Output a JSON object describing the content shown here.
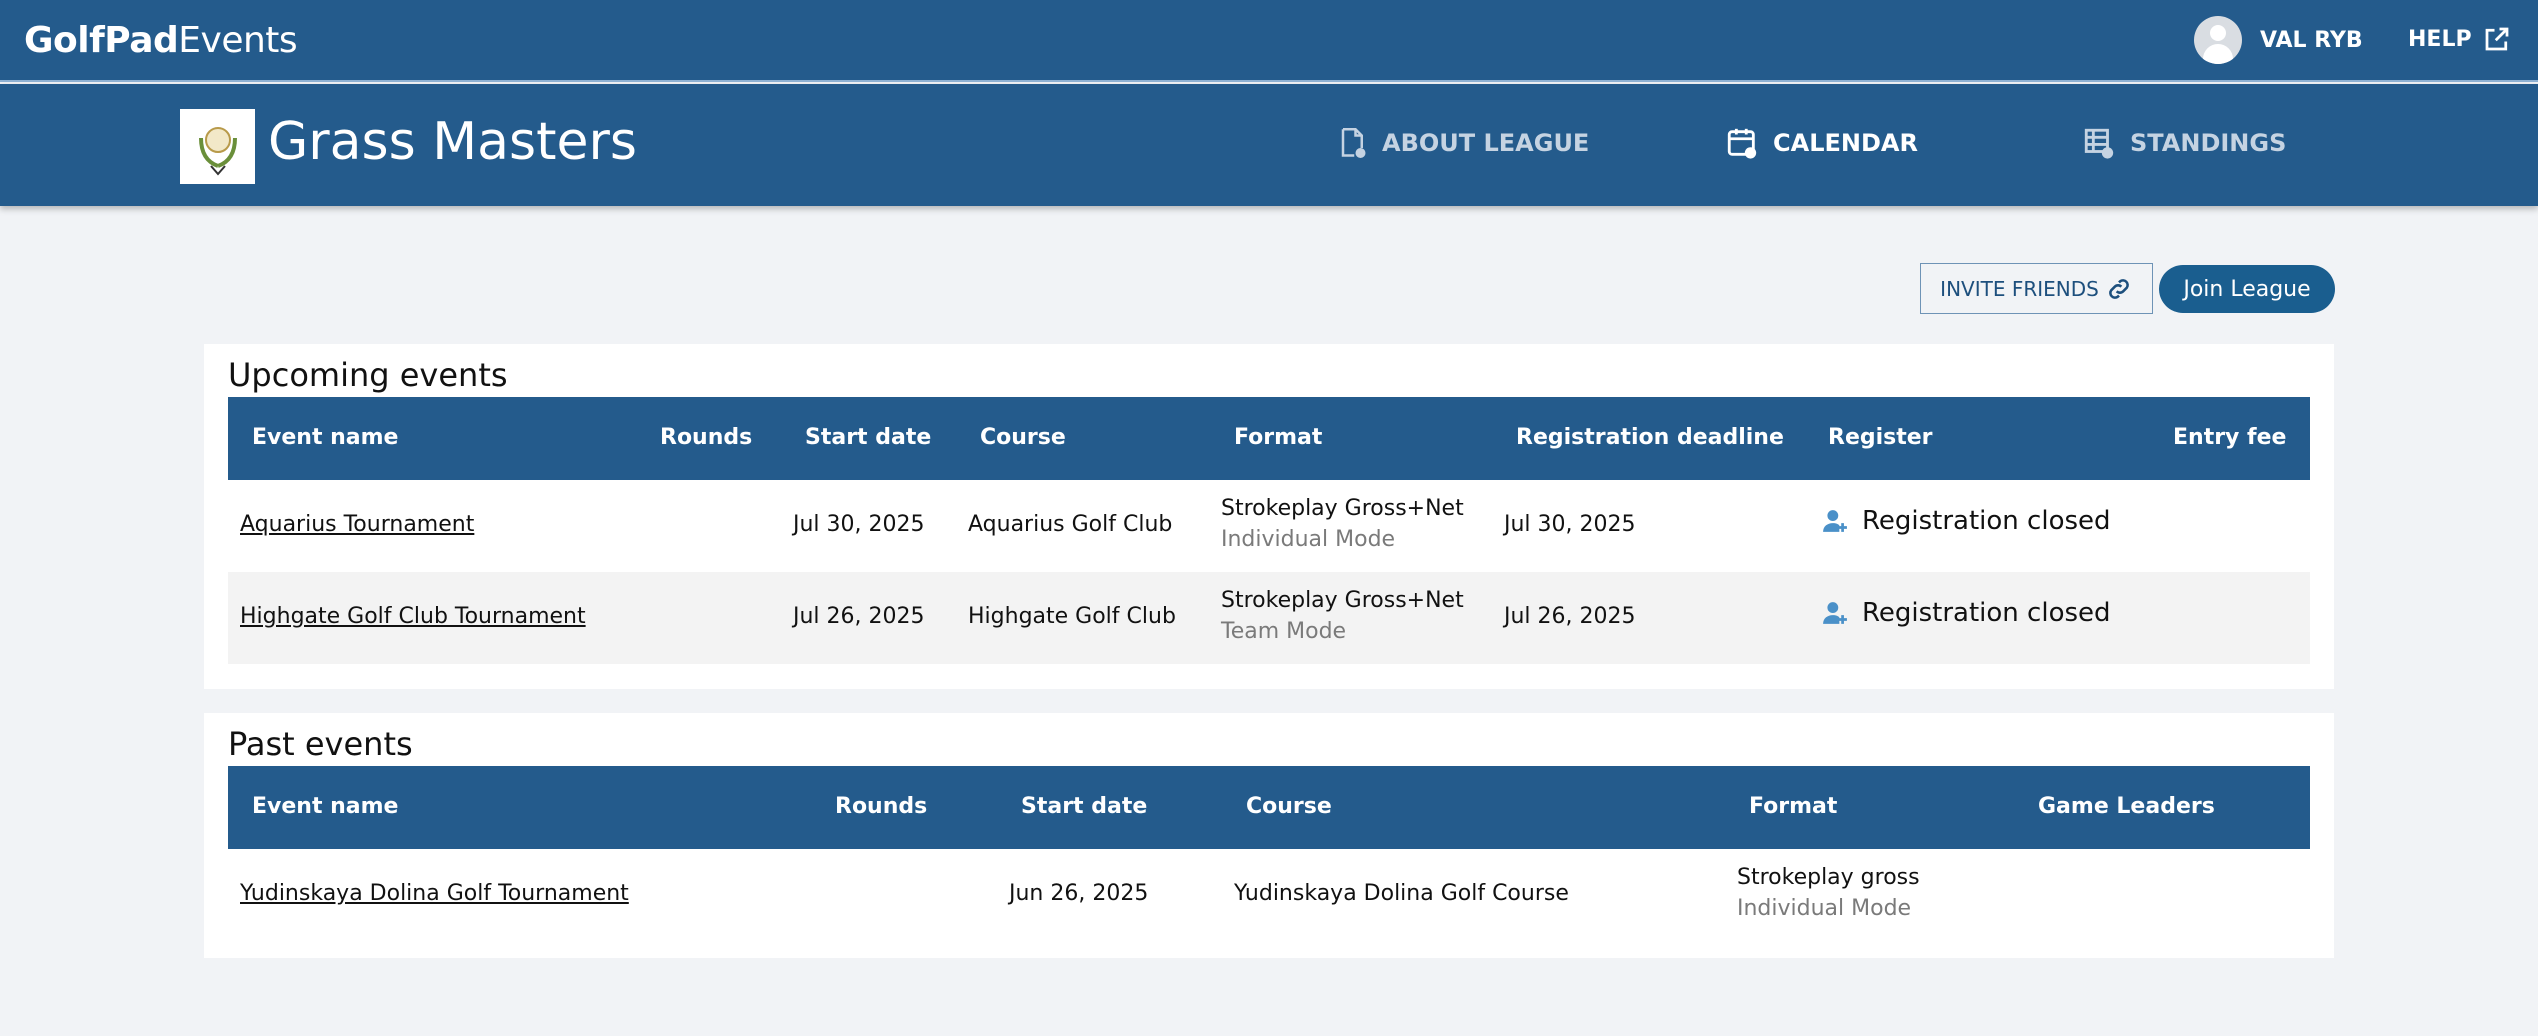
{
  "app": {
    "brand_bold": "GolfPad",
    "brand_light": "Events"
  },
  "user": {
    "name": "VAL RYB"
  },
  "help": {
    "label": "HELP"
  },
  "league": {
    "title": "Grass Masters",
    "nav": [
      {
        "label": "ABOUT LEAGUE",
        "icon": "document-info-icon"
      },
      {
        "label": "CALENDAR",
        "icon": "calendar-check-icon",
        "active": true
      },
      {
        "label": "STANDINGS",
        "icon": "table-info-icon"
      }
    ]
  },
  "actions": {
    "invite_label": "INVITE FRIENDS",
    "join_label": "Join League"
  },
  "upcoming": {
    "title": "Upcoming events",
    "columns": [
      "Event name",
      "Rounds",
      "Start date",
      "Course",
      "Format",
      "Registration deadline",
      "Register",
      "Entry fee"
    ],
    "rows": [
      {
        "name": "Aquarius Tournament",
        "rounds": "",
        "start": "Jul 30, 2025",
        "course": "Aquarius Golf Club",
        "format": "Strokeplay Gross+Net",
        "mode": "Individual Mode",
        "deadline": "Jul 30, 2025",
        "register": "Registration closed",
        "fee": ""
      },
      {
        "name": "Highgate Golf Club Tournament",
        "rounds": "",
        "start": "Jul 26, 2025",
        "course": "Highgate Golf Club",
        "format": "Strokeplay Gross+Net",
        "mode": "Team Mode",
        "deadline": "Jul 26, 2025",
        "register": "Registration closed",
        "fee": ""
      }
    ]
  },
  "past": {
    "title": "Past events",
    "columns": [
      "Event name",
      "Rounds",
      "Start date",
      "Course",
      "Format",
      "Game Leaders"
    ],
    "rows": [
      {
        "name": "Yudinskaya Dolina Golf Tournament",
        "rounds": "",
        "start": "Jun 26, 2025",
        "course": "Yudinskaya Dolina Golf Course",
        "format": "Strokeplay gross",
        "mode": "Individual Mode",
        "leaders": ""
      }
    ]
  },
  "colors": {
    "header": "#245b8c",
    "join": "#1a5e8f",
    "register_icon": "#4a90c8"
  }
}
